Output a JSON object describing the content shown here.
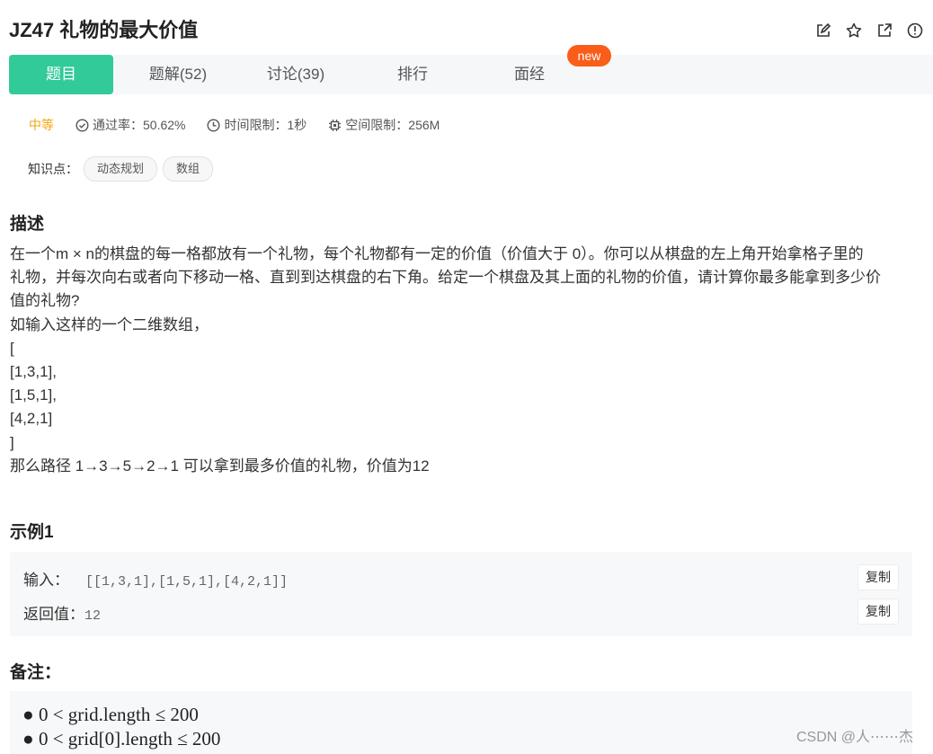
{
  "header": {
    "title": "JZ47  礼物的最大价值",
    "icons": [
      "edit-icon",
      "star-icon",
      "external-link-icon",
      "info-icon"
    ]
  },
  "tabs": [
    {
      "label": "题目",
      "active": true
    },
    {
      "label": "题解(52)"
    },
    {
      "label": "讨论(39)"
    },
    {
      "label": "排行"
    },
    {
      "label": "面经"
    }
  ],
  "new_badge": "new",
  "meta": {
    "difficulty": "中等",
    "pass_rate": "通过率：50.62%",
    "time_limit": "时间限制：1秒",
    "space_limit": "空间限制：256M"
  },
  "knowledge": {
    "label": "知识点：",
    "tags": [
      "动态规划",
      "数组"
    ]
  },
  "description": {
    "heading": "描述",
    "lines": [
      "在一个m × n的棋盘的每一格都放有一个礼物，每个礼物都有一定的价值（价值大于 0）。你可以从棋盘的左上角开始拿格子里的",
      "礼物，并每次向右或者向下移动一格、直到到达棋盘的右下角。给定一个棋盘及其上面的礼物的价值，请计算你最多能拿到多少价",
      "值的礼物?",
      "如输入这样的一个二维数组，",
      "[",
      "[1,3,1],",
      "[1,5,1],",
      "[4,2,1]",
      "]",
      "那么路径 1→3→5→2→1 可以拿到最多价值的礼物，价值为12"
    ]
  },
  "example": {
    "heading": "示例1",
    "input_label": "输入：",
    "input_value": "[[1,3,1],[1,5,1],[4,2,1]]",
    "output_label": "返回值：",
    "output_value": "12",
    "copy_label": "复制"
  },
  "notes": {
    "heading": "备注：",
    "items": [
      "0 < grid.length ≤ 200",
      "0 < grid[0].length ≤ 200"
    ]
  },
  "watermark": "CSDN @人⋯⋯杰",
  "colors": {
    "accent": "#32ca99",
    "badge": "#fa5d19",
    "difficulty": "#f2a614"
  }
}
